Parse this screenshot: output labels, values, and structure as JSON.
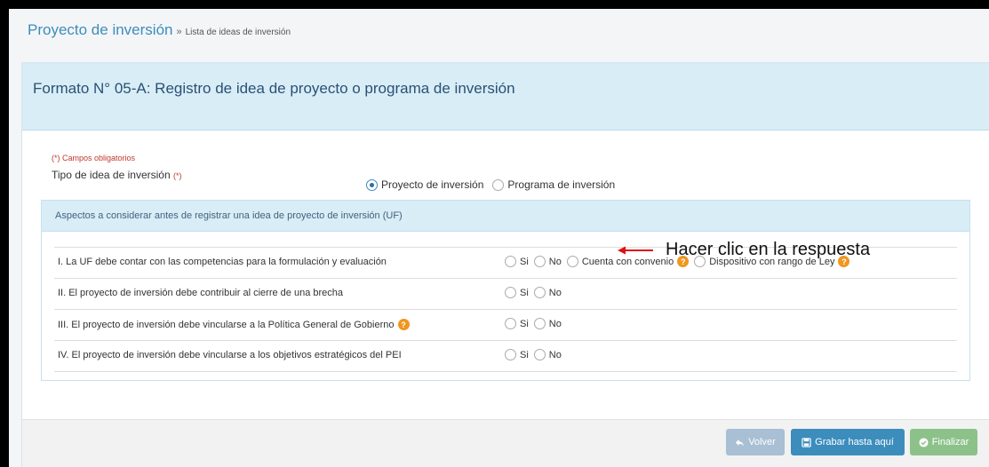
{
  "breadcrumb": {
    "main": "Proyecto de inversión",
    "separator": "»",
    "sub": "Lista de ideas de inversión"
  },
  "panel": {
    "title": "Formato N° 05-A: Registro de idea de proyecto o programa de inversión"
  },
  "form": {
    "required_note": "(*) Campos obligatorios",
    "tipo_label": "Tipo de idea de inversión",
    "required_mark": "(*)",
    "tipo_options": [
      {
        "label": "Proyecto de inversión",
        "selected": true
      },
      {
        "label": "Programa de inversión",
        "selected": false
      }
    ]
  },
  "aspects": {
    "header": "Aspectos a considerar antes de registrar una idea de proyecto de inversión (UF)",
    "questions": [
      {
        "text": "I. La UF debe contar con las competencias para la formulación y evaluación",
        "options": [
          "Si",
          "No",
          "Cuenta con convenio",
          "Dispositivo con rango de Ley"
        ]
      },
      {
        "text": "II. El proyecto de inversión debe contribuir al cierre de una brecha",
        "options": [
          "Si",
          "No"
        ]
      },
      {
        "text": "III. El proyecto de inversión debe vincularse a la Política General de Gobierno",
        "options": [
          "Si",
          "No"
        ]
      },
      {
        "text": "IV. El proyecto de inversión debe vincularse a los objetivos estratégicos del PEI",
        "options": [
          "Si",
          "No"
        ]
      }
    ]
  },
  "annotation": {
    "text": "Hacer clic en la respuesta",
    "arrow_color": "#e01010"
  },
  "buttons": {
    "back": "Volver",
    "save": "Grabar hasta aquí",
    "finish": "Finalizar"
  },
  "icons": {
    "help": "question-circle-icon",
    "back": "reply-icon",
    "save": "floppy-disk-icon",
    "finish": "check-circle-icon"
  },
  "colors": {
    "accent": "#3c8dbc",
    "header_bg": "#d9edf7",
    "required": "#c0392b",
    "help": "#f0961f",
    "finish": "#8cc28a",
    "back": "#a8bfd4"
  }
}
